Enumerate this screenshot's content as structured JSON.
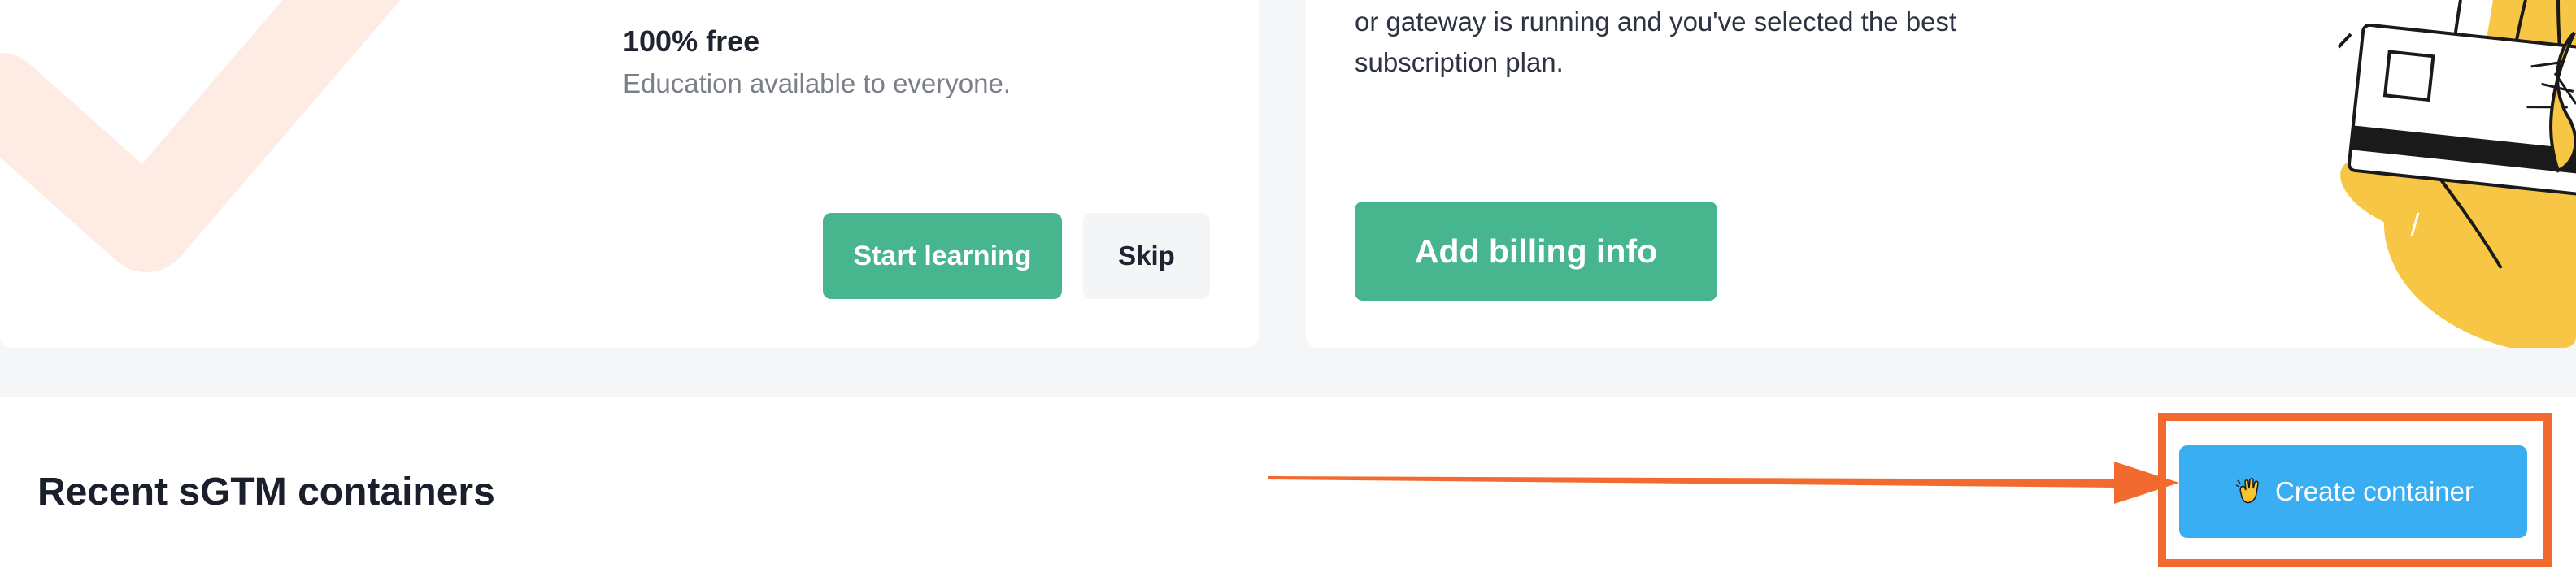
{
  "education_card": {
    "title": "100% free",
    "subtitle": "Education available to everyone.",
    "start_label": "Start learning",
    "skip_label": "Skip"
  },
  "billing_card": {
    "text": "or gateway is running and you've selected the best subscription plan.",
    "button_label": "Add billing info"
  },
  "containers_section": {
    "title": "Recent sGTM containers",
    "create_label": "Create container",
    "create_icon": "waving-hand-icon"
  },
  "colors": {
    "accent_green": "#47b68f",
    "accent_blue": "#3aaef2",
    "highlight_orange": "#f26a2e",
    "illustration_yellow": "#f6c644"
  }
}
